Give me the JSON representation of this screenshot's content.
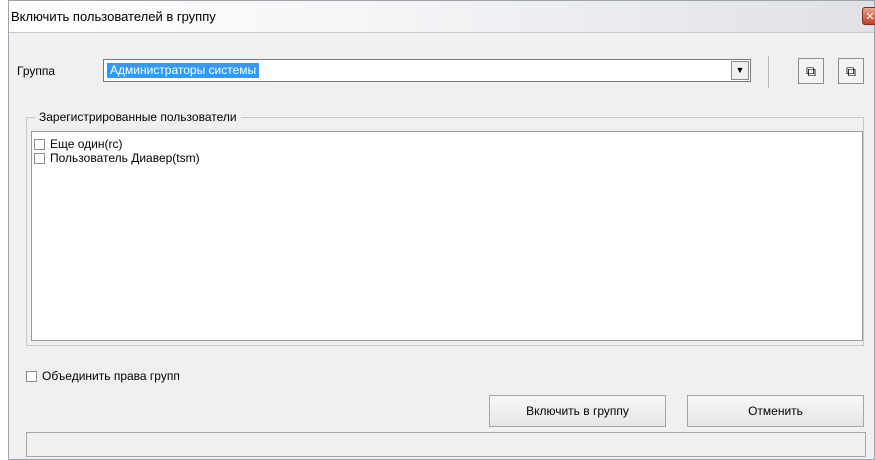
{
  "window": {
    "title": "Включить пользователей в группу",
    "close_glyph": "✕"
  },
  "group": {
    "label": "Группа",
    "selected": "Администраторы системы",
    "dropdown_glyph": "▼"
  },
  "toolbar": {
    "button1_icon": "copy-icon",
    "button1_glyph": "⧉",
    "button2_icon": "duplicate-icon",
    "button2_glyph": "⧉"
  },
  "registered_users": {
    "title": "Зарегистрированные пользователи",
    "items": [
      {
        "label": "Еще один(rc)",
        "checked": false
      },
      {
        "label": "Пользователь Диавер(tsm)",
        "checked": false
      }
    ]
  },
  "merge_rights": {
    "label": "Объединить права групп",
    "checked": false
  },
  "buttons": {
    "include": "Включить в группу",
    "cancel": "Отменить"
  },
  "status": {
    "text": ""
  }
}
